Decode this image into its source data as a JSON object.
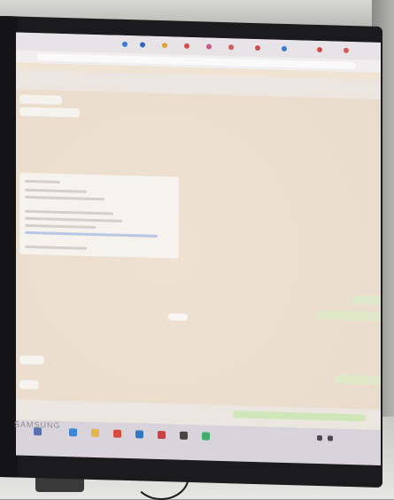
{
  "photo": {
    "subject": "",
    "monitor_brand": "SAMSUNG"
  },
  "colors": {
    "screen_bg": "#efe3d4",
    "incoming_bubble": "#f6f2ee",
    "outgoing_bubble": "#dfe8c8",
    "taskbar": "#d9d4dc"
  },
  "icons": [
    "chrome-icon",
    "search-icon",
    "edge-icon",
    "whatsapp-icon",
    "wifi-icon",
    "speaker-icon"
  ]
}
